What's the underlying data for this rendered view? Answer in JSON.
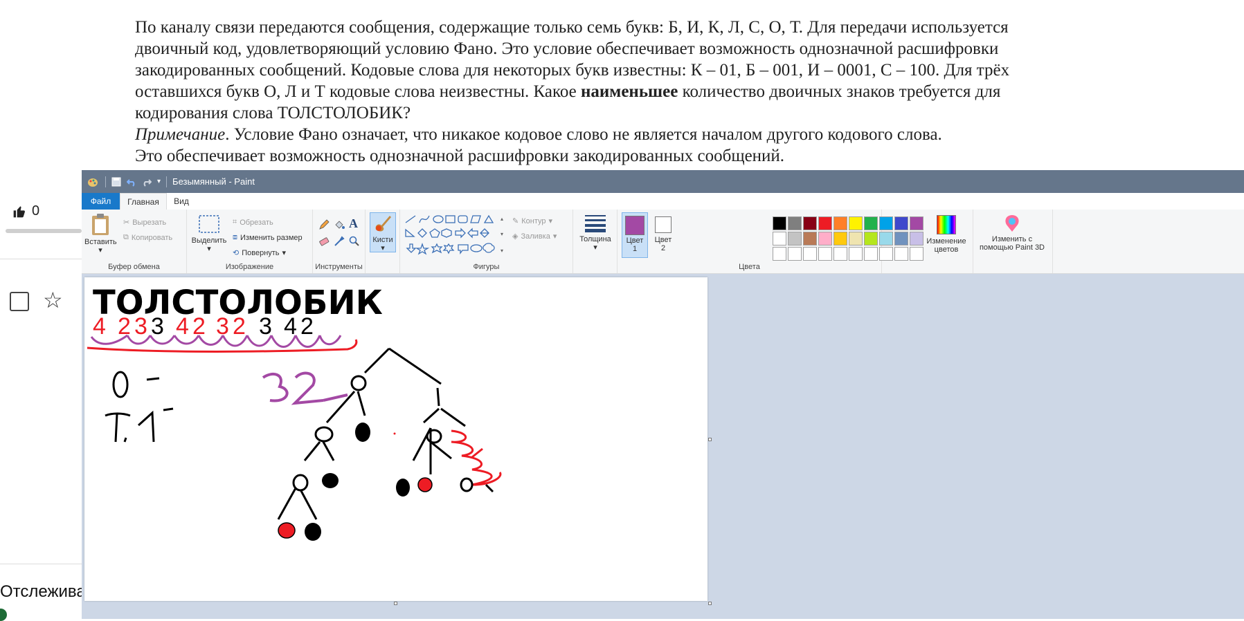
{
  "problem": {
    "line1": "По каналу связи передаются сообщения, содержащие только семь букв: Б, И, К, Л, С, О, Т. Для передачи используется",
    "line2": "двоичный код, удовлетворяющий условию Фано. Это условие обеспечивает возможность однозначной расшифровки",
    "line3": "закодированных сообщений. Кодовые слова для некоторых букв известны: К – 01, Б – 001, И – 0001, С – 100. Для трёх",
    "line4a": "оставшихся букв О, Л и Т кодовые слова неизвестны. Какое",
    "line4bold": "наименьшее",
    "line4b": "количество двоичных знаков требуется для",
    "line5": "кодирования слова ТОЛСТОЛОБИК?",
    "note_label": "Примечание",
    "note_text": ". Условие Фано означает, что никакое кодовое слово не является началом другого кодового слова.",
    "note_line2": "Это обеспечивает возможность однозначной расшифровки закодированных сообщений."
  },
  "left_page": {
    "like_count": "0",
    "tracking_text": "Отслежива"
  },
  "paint": {
    "title": "Безымянный - Paint",
    "tabs": {
      "file": "Файл",
      "home": "Главная",
      "view": "Вид"
    },
    "clipboard": {
      "paste": "Вставить",
      "cut": "Вырезать",
      "copy": "Копировать",
      "label": "Буфер обмена"
    },
    "image": {
      "select": "Выделить",
      "crop": "Обрезать",
      "resize": "Изменить размер",
      "rotate": "Повернуть",
      "label": "Изображение"
    },
    "tools": {
      "label": "Инструменты",
      "text_tool": "A"
    },
    "brushes": {
      "label": "Кисти"
    },
    "shapes": {
      "outline": "Контур",
      "fill": "Заливка",
      "label": "Фигуры"
    },
    "thickness": {
      "label": "Толщина"
    },
    "color1": {
      "label1": "Цвет",
      "label2": "1",
      "value": "#a349a4"
    },
    "color2": {
      "label1": "Цвет",
      "label2": "2",
      "value": "#ffffff"
    },
    "palette_row1": [
      "#000000",
      "#7f7f7f",
      "#880015",
      "#ed1c24",
      "#ff7f27",
      "#fff200",
      "#22b14c",
      "#00a2e8",
      "#3f48cc",
      "#a349a4"
    ],
    "palette_row2": [
      "#ffffff",
      "#c3c3c3",
      "#b97a57",
      "#ffaec9",
      "#ffc90e",
      "#efe4b0",
      "#b5e61d",
      "#99d9ea",
      "#7092be",
      "#c8bfe7"
    ],
    "colors_label": "Цвета",
    "edit_colors": {
      "line1": "Изменение",
      "line2": "цветов"
    },
    "paint3d": {
      "line1": "Изменить с",
      "line2": "помощью Paint 3D"
    }
  },
  "canvas": {
    "word": "ТОЛСТОЛОБИК",
    "digits": [
      {
        "text": "4",
        "color": "#ed1c24"
      },
      {
        "text": "2",
        "color": "#ed1c24"
      },
      {
        "text": "3",
        "color": "#ed1c24"
      },
      {
        "text": "3",
        "color": "#000000"
      },
      {
        "text": "4",
        "color": "#ed1c24"
      },
      {
        "text": "2",
        "color": "#ed1c24"
      },
      {
        "text": "3",
        "color": "#ed1c24"
      },
      {
        "text": "2",
        "color": "#ed1c24"
      },
      {
        "text": "3",
        "color": "#000000"
      },
      {
        "text": "4",
        "color": "#000000"
      },
      {
        "text": "2",
        "color": "#000000"
      }
    ],
    "note_o": "О –",
    "note_t": "Т,1 –",
    "purple_number": "32",
    "tree_label_0": "0",
    "tree_label_1": "1"
  }
}
